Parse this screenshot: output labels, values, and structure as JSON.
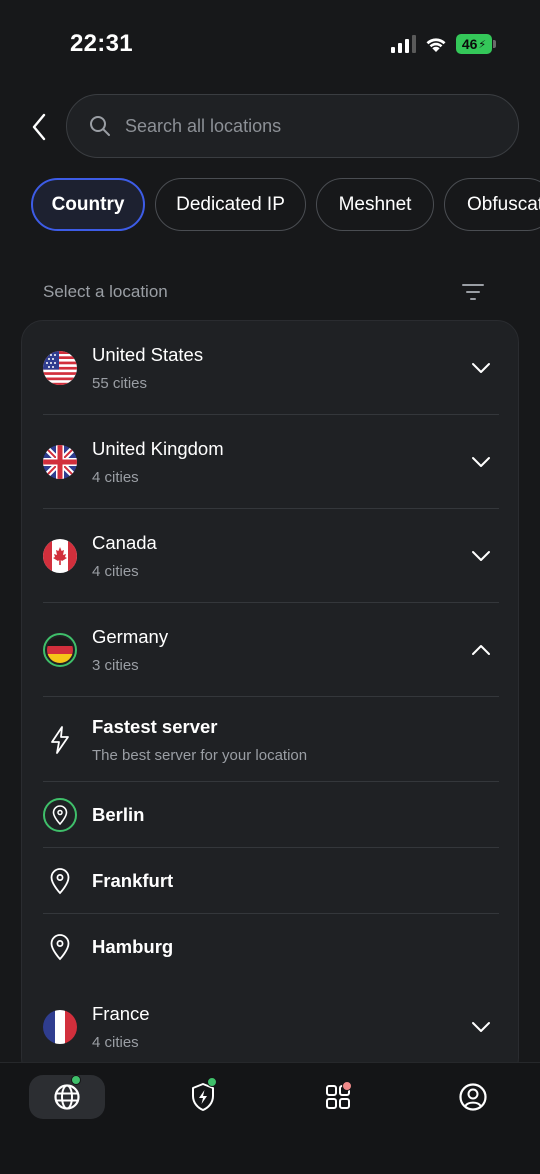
{
  "status_bar": {
    "time": "22:31",
    "battery": "46",
    "battery_color": "#34c759"
  },
  "search": {
    "placeholder": "Search all locations",
    "value": ""
  },
  "tabs": [
    {
      "label": "Country",
      "active": true
    },
    {
      "label": "Dedicated IP",
      "active": false
    },
    {
      "label": "Meshnet",
      "active": false
    },
    {
      "label": "Obfuscat",
      "active": false
    }
  ],
  "section": {
    "title": "Select a location"
  },
  "locations": [
    {
      "name": "United States",
      "sub": "55 cities",
      "flag": "us-flag-icon",
      "expanded": false
    },
    {
      "name": "United Kingdom",
      "sub": "4 cities",
      "flag": "uk-flag-icon",
      "expanded": false
    },
    {
      "name": "Canada",
      "sub": "4 cities",
      "flag": "canada-flag-icon",
      "expanded": false
    },
    {
      "name": "Germany",
      "sub": "3 cities",
      "flag": "germany-flag-icon",
      "expanded": true
    },
    {
      "name": "France",
      "sub": "4 cities",
      "flag": "france-flag-icon",
      "expanded": false
    }
  ],
  "germany_children": {
    "fastest": {
      "title": "Fastest server",
      "sub": "The best server for your location",
      "icon": "lightning-icon"
    },
    "cities": [
      {
        "name": "Berlin",
        "icon": "location-pin-icon",
        "connected": true
      },
      {
        "name": "Frankfurt",
        "icon": "location-pin-icon",
        "connected": false
      },
      {
        "name": "Hamburg",
        "icon": "location-pin-icon",
        "connected": false
      }
    ]
  },
  "bottom_nav": [
    {
      "icon": "globe-icon",
      "active": true,
      "badge_color": "#3fbf6a"
    },
    {
      "icon": "shield-lightning-icon",
      "active": false,
      "badge_color": "#3fbf6a"
    },
    {
      "icon": "apps-grid-icon",
      "active": false,
      "badge_color": "#f08a8a"
    },
    {
      "icon": "profile-icon",
      "active": false
    }
  ],
  "colors": {
    "accent": "#3d5ce6",
    "connected": "#3fbf6a",
    "background": "#17181a",
    "card": "#1f2124"
  }
}
